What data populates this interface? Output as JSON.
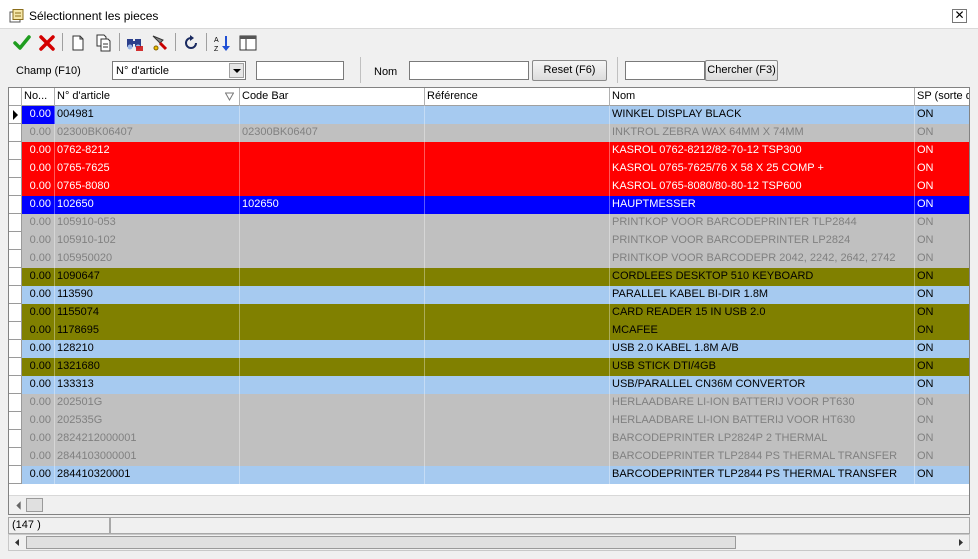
{
  "window": {
    "title": "Sélectionnent les pieces",
    "close_label": "✕"
  },
  "toolbar": {
    "buttons": [
      "ok-icon",
      "cancel-icon",
      "new-doc-icon",
      "copy-doc-icon",
      "find-icon",
      "filter-icon",
      "refresh-icon",
      "sort-icon",
      "columns-icon"
    ]
  },
  "filter": {
    "champ_label": "Champ (F10)",
    "champ_value": "N° d'article",
    "champ_input": "",
    "nom_label": "Nom",
    "nom_input": "",
    "reset_label": "Reset (F6)",
    "search_input": "",
    "search_label": "Chercher (F3)"
  },
  "grid": {
    "columns": [
      "No...",
      "N° d'article",
      "Code Bar",
      "Référence",
      "Nom",
      "SP (sorte d"
    ],
    "rows": [
      {
        "qty": "0.00",
        "article": "004981",
        "code": "",
        "ref": "",
        "nom": "WINKEL DISPLAY BLACK",
        "sp": "ON",
        "style": "lightblue",
        "current": true
      },
      {
        "qty": "0.00",
        "article": "02300BK06407",
        "code": "02300BK06407",
        "ref": "",
        "nom": "INKTROL ZEBRA WAX 64MM X 74MM",
        "sp": "ON",
        "style": "gray"
      },
      {
        "qty": "0.00",
        "article": "0762-8212",
        "code": "",
        "ref": "",
        "nom": "KASROL 0762-8212/82-70-12 TSP300",
        "sp": "ON",
        "style": "red"
      },
      {
        "qty": "0.00",
        "article": "0765-7625",
        "code": "",
        "ref": "",
        "nom": "KASROL 0765-7625/76 X 58 X 25 COMP +",
        "sp": "ON",
        "style": "red"
      },
      {
        "qty": "0.00",
        "article": "0765-8080",
        "code": "",
        "ref": "",
        "nom": "KASROL 0765-8080/80-80-12 TSP600",
        "sp": "ON",
        "style": "red"
      },
      {
        "qty": "0.00",
        "article": "102650",
        "code": "102650",
        "ref": "",
        "nom": "HAUPTMESSER",
        "sp": "ON",
        "style": "blue"
      },
      {
        "qty": "0.00",
        "article": "105910-053",
        "code": "",
        "ref": "",
        "nom": "PRINTKOP VOOR BARCODEPRINTER TLP2844",
        "sp": "ON",
        "style": "gray"
      },
      {
        "qty": "0.00",
        "article": "105910-102",
        "code": "",
        "ref": "",
        "nom": "PRINTKOP VOOR BARCODEPRINTER  LP2824",
        "sp": "ON",
        "style": "gray"
      },
      {
        "qty": "0.00",
        "article": "105950020",
        "code": "",
        "ref": "",
        "nom": "PRINTKOP VOOR BARCODEPR 2042, 2242, 2642, 2742",
        "sp": "ON",
        "style": "gray"
      },
      {
        "qty": "0.00",
        "article": "1090647",
        "code": "",
        "ref": "",
        "nom": "CORDLEES DESKTOP 510 KEYBOARD",
        "sp": "ON",
        "style": "olive"
      },
      {
        "qty": "0.00",
        "article": "113590",
        "code": "",
        "ref": "",
        "nom": "PARALLEL KABEL BI-DIR 1.8M",
        "sp": "ON",
        "style": "lightblue"
      },
      {
        "qty": "0.00",
        "article": "1155074",
        "code": "",
        "ref": "",
        "nom": "CARD READER 15 IN USB 2.0",
        "sp": "ON",
        "style": "olive"
      },
      {
        "qty": "0.00",
        "article": "1178695",
        "code": "",
        "ref": "",
        "nom": "MCAFEE",
        "sp": "ON",
        "style": "olive"
      },
      {
        "qty": "0.00",
        "article": "128210",
        "code": "",
        "ref": "",
        "nom": "USB 2.0 KABEL 1.8M A/B",
        "sp": "ON",
        "style": "lightblue"
      },
      {
        "qty": "0.00",
        "article": "1321680",
        "code": "",
        "ref": "",
        "nom": "USB STICK DTI/4GB",
        "sp": "ON",
        "style": "olive"
      },
      {
        "qty": "0.00",
        "article": "133313",
        "code": "",
        "ref": "",
        "nom": "USB/PARALLEL CN36M CONVERTOR",
        "sp": "ON",
        "style": "lightblue"
      },
      {
        "qty": "0.00",
        "article": "202501G",
        "code": "",
        "ref": "",
        "nom": "HERLAADBARE LI-ION BATTERIJ VOOR PT630",
        "sp": "ON",
        "style": "gray"
      },
      {
        "qty": "0.00",
        "article": "202535G",
        "code": "",
        "ref": "",
        "nom": "HERLAADBARE LI-ION BATTERIJ VOOR  HT630",
        "sp": "ON",
        "style": "gray"
      },
      {
        "qty": "0.00",
        "article": "2824212000001",
        "code": "",
        "ref": "",
        "nom": "BARCODEPRINTER LP2824P 2 THERMAL",
        "sp": "ON",
        "style": "gray"
      },
      {
        "qty": "0.00",
        "article": "2844103000001",
        "code": "",
        "ref": "",
        "nom": "BARCODEPRINTER TLP2844 PS THERMAL TRANSFER",
        "sp": "ON",
        "style": "gray"
      },
      {
        "qty": "0.00",
        "article": "284410320001",
        "code": "",
        "ref": "",
        "nom": "BARCODEPRINTER TLP2844 PS THERMAL TRANSFER",
        "sp": "ON",
        "style": "lightblue"
      }
    ]
  },
  "styles": {
    "lightblue": {
      "bg": "#a6caf0",
      "fg": "#000000"
    },
    "gray": {
      "bg": "#c0c0c0",
      "fg": "#808080"
    },
    "red": {
      "bg": "#ff0000",
      "fg": "#ffffff"
    },
    "blue": {
      "bg": "#0000ff",
      "fg": "#ffffff"
    },
    "olive": {
      "bg": "#808000",
      "fg": "#000000"
    }
  },
  "status": {
    "count": "(147 )"
  }
}
